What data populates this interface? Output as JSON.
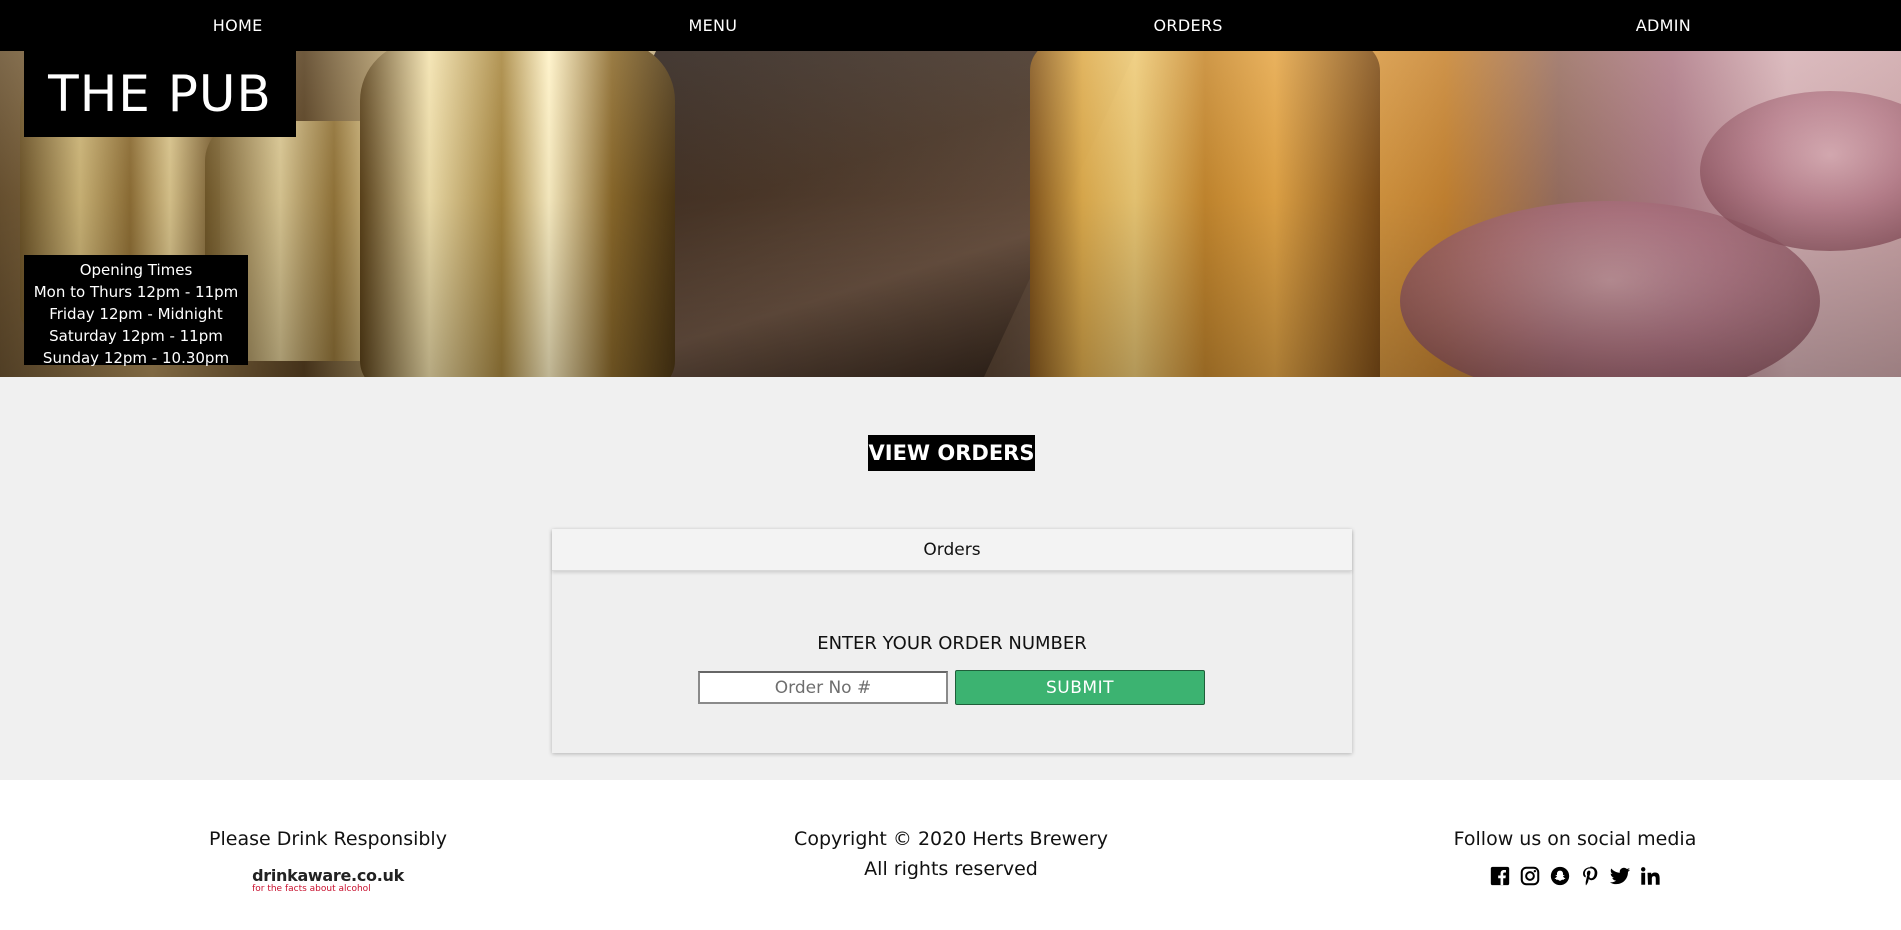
{
  "nav": {
    "items": [
      {
        "label": "HOME"
      },
      {
        "label": "MENU"
      },
      {
        "label": "ORDERS"
      },
      {
        "label": "ADMIN"
      }
    ]
  },
  "hero": {
    "title": "THE PUB",
    "hours": {
      "heading": "Opening Times",
      "lines": [
        "Mon to Thurs 12pm - 11pm",
        "Friday 12pm - Midnight",
        "Saturday 12pm - 11pm",
        "Sunday 12pm - 10.30pm"
      ]
    }
  },
  "main": {
    "page_heading": "VIEW ORDERS",
    "card": {
      "header": "Orders",
      "prompt": "ENTER YOUR ORDER NUMBER",
      "input_placeholder": "Order No #",
      "input_value": "",
      "submit_label": "SUBMIT"
    }
  },
  "footer": {
    "left": {
      "text": "Please Drink Responsibly",
      "logo_name": "drinkaware.co.uk",
      "logo_tagline": "for the facts about alcohol"
    },
    "center": {
      "line1": "Copyright © 2020 Herts Brewery",
      "line2": "All rights reserved"
    },
    "right": {
      "text": "Follow us on social media",
      "icons": [
        "facebook-icon",
        "instagram-icon",
        "snapchat-icon",
        "pinterest-icon",
        "twitter-icon",
        "linkedin-icon"
      ]
    }
  },
  "colors": {
    "nav_bg": "#000000",
    "main_bg": "#f0f0f0",
    "submit_bg": "#3cb371",
    "drinkaware_red": "#c8102e"
  }
}
